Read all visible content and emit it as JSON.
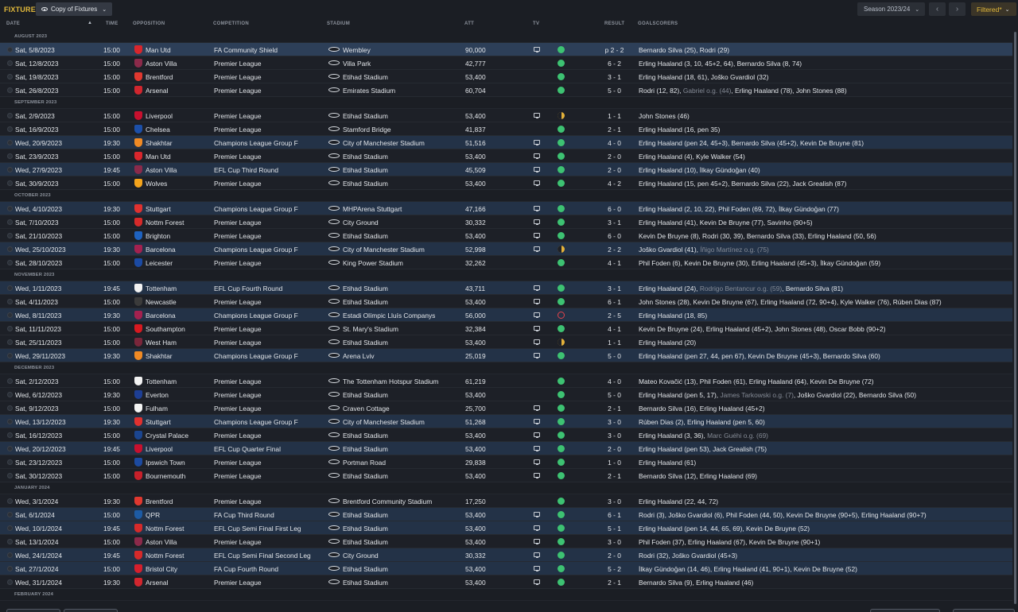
{
  "topbar": {
    "title": "FIXTURES",
    "view_label": "Copy of Fixtures",
    "season_label": "Season 2023/24",
    "filter_label": "Filtered*"
  },
  "columns": {
    "date": "DATE",
    "time": "TIME",
    "opposition": "OPPOSITION",
    "competition": "COMPETITION",
    "stadium": "STADIUM",
    "att": "ATT",
    "tv": "TV",
    "result": "RESULT",
    "goalscorers": "GOALSCORERS"
  },
  "colors": {
    "accent": "#e2b93b",
    "win": "#3dc272",
    "draw": "#e3b13a",
    "loss": "#e2434b",
    "row_highlight": "#233247"
  },
  "sections": [
    {
      "month": "AUGUST 2023",
      "rows": [
        {
          "date": "Sat, 5/8/2023",
          "time": "15:00",
          "opp": "Man Utd",
          "badge": "#d9262c",
          "comp": "FA Community Shield",
          "stadium": "Wembley",
          "att": "90,000",
          "tv": true,
          "status": "win",
          "result": "p 2 - 2",
          "style": "first",
          "scorers": "Bernardo Silva (25), Rodri (29)",
          "og": ""
        },
        {
          "date": "Sat, 12/8/2023",
          "time": "15:00",
          "opp": "Aston Villa",
          "badge": "#8b2a4a",
          "comp": "Premier League",
          "stadium": "Villa Park",
          "att": "42,777",
          "tv": false,
          "status": "win",
          "result": "6 - 2",
          "style": "home",
          "scorers": "Erling Haaland (3, 10, 45+2, 64), Bernardo Silva (8, 74)",
          "og": ""
        },
        {
          "date": "Sat, 19/8/2023",
          "time": "15:00",
          "opp": "Brentford",
          "badge": "#e0382f",
          "comp": "Premier League",
          "stadium": "Etihad Stadium",
          "att": "53,400",
          "tv": false,
          "status": "win",
          "result": "3 - 1",
          "style": "home",
          "scorers": "Erling Haaland (18, 61), Joško Gvardiol (32)",
          "og": ""
        },
        {
          "date": "Sat, 26/8/2023",
          "time": "15:00",
          "opp": "Arsenal",
          "badge": "#d1262e",
          "comp": "Premier League",
          "stadium": "Emirates Stadium",
          "att": "60,704",
          "tv": false,
          "status": "win",
          "result": "5 - 0",
          "style": "home",
          "scorers": "Rodri (12, 82), ",
          "og": "Gabriel o.g. (44)",
          "scorers2": ", Erling Haaland (78), John Stones (88)"
        }
      ]
    },
    {
      "month": "SEPTEMBER 2023",
      "rows": [
        {
          "date": "Sat, 2/9/2023",
          "time": "15:00",
          "opp": "Liverpool",
          "badge": "#c8102e",
          "comp": "Premier League",
          "stadium": "Etihad Stadium",
          "att": "53,400",
          "tv": true,
          "status": "draw",
          "result": "1 - 1",
          "style": "home",
          "scorers": "John Stones (46)",
          "og": ""
        },
        {
          "date": "Sat, 16/9/2023",
          "time": "15:00",
          "opp": "Chelsea",
          "badge": "#1c4fa8",
          "comp": "Premier League",
          "stadium": "Stamford Bridge",
          "att": "41,837",
          "tv": false,
          "status": "win",
          "result": "2 - 1",
          "style": "home",
          "scorers": "Erling Haaland (16, pen 35)",
          "og": ""
        },
        {
          "date": "Wed, 20/9/2023",
          "time": "19:30",
          "opp": "Shakhtar",
          "badge": "#f08a24",
          "comp": "Champions League Group F",
          "stadium": "City of Manchester Stadium",
          "att": "51,516",
          "tv": true,
          "status": "win",
          "result": "4 - 0",
          "style": "cup",
          "scorers": "Erling Haaland (pen 24, 45+3), Bernardo Silva (45+2), Kevin De Bruyne (81)",
          "og": ""
        },
        {
          "date": "Sat, 23/9/2023",
          "time": "15:00",
          "opp": "Man Utd",
          "badge": "#d9262c",
          "comp": "Premier League",
          "stadium": "Etihad Stadium",
          "att": "53,400",
          "tv": true,
          "status": "win",
          "result": "2 - 0",
          "style": "home",
          "scorers": "Erling Haaland (4), Kyle Walker (54)",
          "og": ""
        },
        {
          "date": "Wed, 27/9/2023",
          "time": "19:45",
          "opp": "Aston Villa",
          "badge": "#8b2a4a",
          "comp": "EFL Cup Third Round",
          "stadium": "Etihad Stadium",
          "att": "45,509",
          "tv": true,
          "status": "win",
          "result": "2 - 0",
          "style": "cup",
          "scorers": "Erling Haaland (10), İlkay Gündoğan (40)",
          "og": ""
        },
        {
          "date": "Sat, 30/9/2023",
          "time": "15:00",
          "opp": "Wolves",
          "badge": "#f4a41c",
          "comp": "Premier League",
          "stadium": "Etihad Stadium",
          "att": "53,400",
          "tv": true,
          "status": "win",
          "result": "4 - 2",
          "style": "home",
          "scorers": "Erling Haaland (15, pen 45+2), Bernardo Silva (22), Jack Grealish (87)",
          "og": ""
        }
      ]
    },
    {
      "month": "OCTOBER 2023",
      "rows": [
        {
          "date": "Wed, 4/10/2023",
          "time": "19:30",
          "opp": "Stuttgart",
          "badge": "#e0312f",
          "comp": "Champions League Group F",
          "stadium": "MHPArena Stuttgart",
          "att": "47,166",
          "tv": true,
          "status": "win",
          "result": "6 - 0",
          "style": "cup",
          "scorers": "Erling Haaland (2, 10, 22), Phil Foden (69, 72), İlkay Gündoğan (77)",
          "og": ""
        },
        {
          "date": "Sat, 7/10/2023",
          "time": "15:00",
          "opp": "Nottm Forest",
          "badge": "#d62a2a",
          "comp": "Premier League",
          "stadium": "City Ground",
          "att": "30,332",
          "tv": true,
          "status": "win",
          "result": "3 - 1",
          "style": "home",
          "scorers": "Erling Haaland (41), Kevin De Bruyne (77), Savinho (90+5)",
          "og": ""
        },
        {
          "date": "Sat, 21/10/2023",
          "time": "15:00",
          "opp": "Brighton",
          "badge": "#1e62c0",
          "comp": "Premier League",
          "stadium": "Etihad Stadium",
          "att": "53,400",
          "tv": true,
          "status": "win",
          "result": "6 - 0",
          "style": "home",
          "scorers": "Kevin De Bruyne (8), Rodri (30, 39), Bernardo Silva (33), Erling Haaland (50, 56)",
          "og": ""
        },
        {
          "date": "Wed, 25/10/2023",
          "time": "19:30",
          "opp": "Barcelona",
          "badge": "#a4214f",
          "comp": "Champions League Group F",
          "stadium": "City of Manchester Stadium",
          "att": "52,998",
          "tv": true,
          "status": "draw",
          "result": "2 - 2",
          "style": "cup",
          "scorers": "Joško Gvardiol (41), ",
          "og": "Íñigo Martínez o.g. (75)"
        },
        {
          "date": "Sat, 28/10/2023",
          "time": "15:00",
          "opp": "Leicester",
          "badge": "#1b4aa3",
          "comp": "Premier League",
          "stadium": "King Power Stadium",
          "att": "32,262",
          "tv": false,
          "status": "win",
          "result": "4 - 1",
          "style": "home",
          "scorers": "Phil Foden (6), Kevin De Bruyne (30), Erling Haaland (45+3), İlkay Gündoğan (59)",
          "og": ""
        }
      ]
    },
    {
      "month": "NOVEMBER 2023",
      "rows": [
        {
          "date": "Wed, 1/11/2023",
          "time": "19:45",
          "opp": "Tottenham",
          "badge": "#f2f2f2",
          "comp": "EFL Cup Fourth Round",
          "stadium": "Etihad Stadium",
          "att": "43,711",
          "tv": true,
          "status": "win",
          "result": "3 - 1",
          "style": "cup",
          "scorers": "Erling Haaland (24), ",
          "og": "Rodrigo Bentancur o.g. (59)",
          "scorers2": ", Bernardo Silva (81)"
        },
        {
          "date": "Sat, 4/11/2023",
          "time": "15:00",
          "opp": "Newcastle",
          "badge": "#3b3b3b",
          "comp": "Premier League",
          "stadium": "Etihad Stadium",
          "att": "53,400",
          "tv": true,
          "status": "win",
          "result": "6 - 1",
          "style": "home",
          "scorers": "John Stones (28), Kevin De Bruyne (67), Erling Haaland (72, 90+4), Kyle Walker (76), Rúben Dias (87)",
          "og": ""
        },
        {
          "date": "Wed, 8/11/2023",
          "time": "19:30",
          "opp": "Barcelona",
          "badge": "#a4214f",
          "comp": "Champions League Group F",
          "stadium": "Estadi Olímpic Lluís Companys",
          "att": "56,000",
          "tv": true,
          "status": "loss",
          "result": "2 - 5",
          "style": "cup",
          "scorers": "Erling Haaland (18, 85)",
          "og": ""
        },
        {
          "date": "Sat, 11/11/2023",
          "time": "15:00",
          "opp": "Southampton",
          "badge": "#d71920",
          "comp": "Premier League",
          "stadium": "St. Mary's Stadium",
          "att": "32,384",
          "tv": true,
          "status": "win",
          "result": "4 - 1",
          "style": "home",
          "scorers": "Kevin De Bruyne (24), Erling Haaland (45+2), John Stones (48), Oscar Bobb (90+2)",
          "og": ""
        },
        {
          "date": "Sat, 25/11/2023",
          "time": "15:00",
          "opp": "West Ham",
          "badge": "#7a263a",
          "comp": "Premier League",
          "stadium": "Etihad Stadium",
          "att": "53,400",
          "tv": true,
          "status": "draw",
          "result": "1 - 1",
          "style": "home",
          "scorers": "Erling Haaland (20)",
          "og": ""
        },
        {
          "date": "Wed, 29/11/2023",
          "time": "19:30",
          "opp": "Shakhtar",
          "badge": "#f08a24",
          "comp": "Champions League Group F",
          "stadium": "Arena Lviv",
          "att": "25,019",
          "tv": true,
          "status": "win",
          "result": "5 - 0",
          "style": "cup",
          "scorers": "Erling Haaland (pen 27, 44, pen 67), Kevin De Bruyne (45+3), Bernardo Silva (60)",
          "og": ""
        }
      ]
    },
    {
      "month": "DECEMBER 2023",
      "rows": [
        {
          "date": "Sat, 2/12/2023",
          "time": "15:00",
          "opp": "Tottenham",
          "badge": "#f2f2f2",
          "comp": "Premier League",
          "stadium": "The Tottenham Hotspur Stadium",
          "att": "61,219",
          "tv": false,
          "status": "win",
          "result": "4 - 0",
          "style": "home",
          "scorers": "Mateo Kovačić (13), Phil Foden (61), Erling Haaland (64), Kevin De Bruyne (72)",
          "og": ""
        },
        {
          "date": "Wed, 6/12/2023",
          "time": "19:30",
          "opp": "Everton",
          "badge": "#1d3e94",
          "comp": "Premier League",
          "stadium": "Etihad Stadium",
          "att": "53,400",
          "tv": false,
          "status": "win",
          "result": "5 - 0",
          "style": "home",
          "scorers": "Erling Haaland (pen 5, 17), ",
          "og": "James Tarkowski o.g. (7)",
          "scorers2": ", Joško Gvardiol (22), Bernardo Silva (50)"
        },
        {
          "date": "Sat, 9/12/2023",
          "time": "15:00",
          "opp": "Fulham",
          "badge": "#f4f4f4",
          "comp": "Premier League",
          "stadium": "Craven Cottage",
          "att": "25,700",
          "tv": true,
          "status": "win",
          "result": "2 - 1",
          "style": "home",
          "scorers": "Bernardo Silva (16), Erling Haaland (45+2)",
          "og": ""
        },
        {
          "date": "Wed, 13/12/2023",
          "time": "19:30",
          "opp": "Stuttgart",
          "badge": "#e0312f",
          "comp": "Champions League Group F",
          "stadium": "City of Manchester Stadium",
          "att": "51,268",
          "tv": true,
          "status": "win",
          "result": "3 - 0",
          "style": "cup",
          "scorers": "Rúben Dias (2), Erling Haaland (pen 5, 60)",
          "og": ""
        },
        {
          "date": "Sat, 16/12/2023",
          "time": "15:00",
          "opp": "Crystal Palace",
          "badge": "#1b458f",
          "comp": "Premier League",
          "stadium": "Etihad Stadium",
          "att": "53,400",
          "tv": true,
          "status": "win",
          "result": "3 - 0",
          "style": "home",
          "scorers": "Erling Haaland (3, 36), ",
          "og": "Marc Guéhi o.g. (69)"
        },
        {
          "date": "Wed, 20/12/2023",
          "time": "19:45",
          "opp": "Liverpool",
          "badge": "#c8102e",
          "comp": "EFL Cup Quarter Final",
          "stadium": "Etihad Stadium",
          "att": "53,400",
          "tv": true,
          "status": "win",
          "result": "2 - 0",
          "style": "cup",
          "scorers": "Erling Haaland (pen 53), Jack Grealish (75)",
          "og": ""
        },
        {
          "date": "Sat, 23/12/2023",
          "time": "15:00",
          "opp": "Ipswich Town",
          "badge": "#1c4aa0",
          "comp": "Premier League",
          "stadium": "Portman Road",
          "att": "29,838",
          "tv": true,
          "status": "win",
          "result": "1 - 0",
          "style": "home",
          "scorers": "Erling Haaland (61)",
          "og": ""
        },
        {
          "date": "Sat, 30/12/2023",
          "time": "15:00",
          "opp": "Bournemouth",
          "badge": "#c8202a",
          "comp": "Premier League",
          "stadium": "Etihad Stadium",
          "att": "53,400",
          "tv": true,
          "status": "win",
          "result": "2 - 1",
          "style": "home",
          "scorers": "Bernardo Silva (12), Erling Haaland (69)",
          "og": ""
        }
      ]
    },
    {
      "month": "JANUARY 2024",
      "rows": [
        {
          "date": "Wed, 3/1/2024",
          "time": "19:30",
          "opp": "Brentford",
          "badge": "#e0382f",
          "comp": "Premier League",
          "stadium": "Brentford Community Stadium",
          "att": "17,250",
          "tv": false,
          "status": "win",
          "result": "3 - 0",
          "style": "home",
          "scorers": "Erling Haaland (22, 44, 72)",
          "og": ""
        },
        {
          "date": "Sat, 6/1/2024",
          "time": "15:00",
          "opp": "QPR",
          "badge": "#1d5ba4",
          "comp": "FA Cup Third Round",
          "stadium": "Etihad Stadium",
          "att": "53,400",
          "tv": true,
          "status": "win",
          "result": "6 - 1",
          "style": "cup",
          "scorers": "Rodri (3), Joško Gvardiol (6), Phil Foden (44, 50), Kevin De Bruyne (90+5), Erling Haaland (90+7)",
          "og": ""
        },
        {
          "date": "Wed, 10/1/2024",
          "time": "19:45",
          "opp": "Nottm Forest",
          "badge": "#d62a2a",
          "comp": "EFL Cup Semi Final First Leg",
          "stadium": "Etihad Stadium",
          "att": "53,400",
          "tv": true,
          "status": "win",
          "result": "5 - 1",
          "style": "cup",
          "scorers": "Erling Haaland (pen 14, 44, 65, 69), Kevin De Bruyne (52)",
          "og": ""
        },
        {
          "date": "Sat, 13/1/2024",
          "time": "15:00",
          "opp": "Aston Villa",
          "badge": "#8b2a4a",
          "comp": "Premier League",
          "stadium": "Etihad Stadium",
          "att": "53,400",
          "tv": true,
          "status": "win",
          "result": "3 - 0",
          "style": "home",
          "scorers": "Phil Foden (37), Erling Haaland (67), Kevin De Bruyne (90+1)",
          "og": ""
        },
        {
          "date": "Wed, 24/1/2024",
          "time": "19:45",
          "opp": "Nottm Forest",
          "badge": "#d62a2a",
          "comp": "EFL Cup Semi Final Second Leg",
          "stadium": "City Ground",
          "att": "30,332",
          "tv": true,
          "status": "win",
          "result": "2 - 0",
          "style": "cup",
          "scorers": "Rodri (32), Joško Gvardiol (45+3)",
          "og": ""
        },
        {
          "date": "Sat, 27/1/2024",
          "time": "15:00",
          "opp": "Bristol City",
          "badge": "#d61f2c",
          "comp": "FA Cup Fourth Round",
          "stadium": "Etihad Stadium",
          "att": "53,400",
          "tv": true,
          "status": "win",
          "result": "5 - 2",
          "style": "cup",
          "scorers": "İlkay Gündoğan (14, 46), Erling Haaland (41, 90+1), Kevin De Bruyne (52)",
          "og": ""
        },
        {
          "date": "Wed, 31/1/2024",
          "time": "19:30",
          "opp": "Arsenal",
          "badge": "#d1262e",
          "comp": "Premier League",
          "stadium": "Etihad Stadium",
          "att": "53,400",
          "tv": true,
          "status": "win",
          "result": "2 - 1",
          "style": "home",
          "scorers": "Bernardo Silva (9), Erling Haaland (46)",
          "og": ""
        }
      ]
    },
    {
      "month": "FEBRUARY 2024",
      "rows": []
    }
  ]
}
